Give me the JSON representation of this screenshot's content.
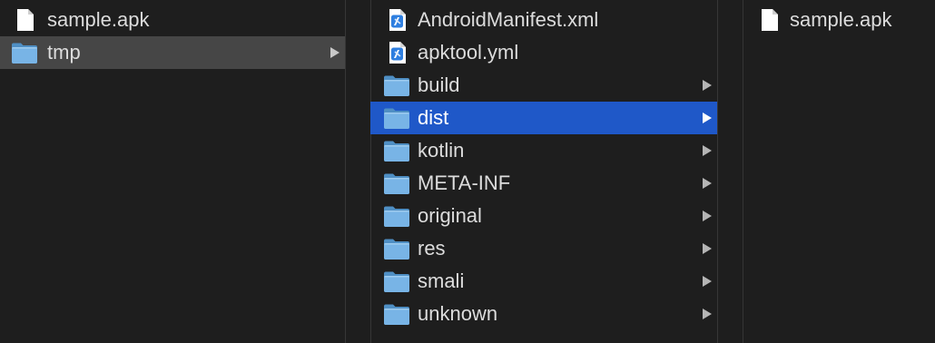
{
  "columns": [
    {
      "items": [
        {
          "name": "sample.apk",
          "type": "file",
          "state": "normal",
          "has_children": false
        },
        {
          "name": "tmp",
          "type": "folder",
          "state": "parent-selected",
          "has_children": true
        }
      ]
    },
    {
      "items": [
        {
          "name": "AndroidManifest.xml",
          "type": "xml-file",
          "state": "normal",
          "has_children": false
        },
        {
          "name": "apktool.yml",
          "type": "xml-file",
          "state": "normal",
          "has_children": false
        },
        {
          "name": "build",
          "type": "folder",
          "state": "normal",
          "has_children": true
        },
        {
          "name": "dist",
          "type": "folder",
          "state": "selected",
          "has_children": true
        },
        {
          "name": "kotlin",
          "type": "folder",
          "state": "normal",
          "has_children": true
        },
        {
          "name": "META-INF",
          "type": "folder",
          "state": "normal",
          "has_children": true
        },
        {
          "name": "original",
          "type": "folder",
          "state": "normal",
          "has_children": true
        },
        {
          "name": "res",
          "type": "folder",
          "state": "normal",
          "has_children": true
        },
        {
          "name": "smali",
          "type": "folder",
          "state": "normal",
          "has_children": true
        },
        {
          "name": "unknown",
          "type": "folder",
          "state": "normal",
          "has_children": true
        }
      ]
    },
    {
      "items": [
        {
          "name": "sample.apk",
          "type": "file",
          "state": "normal",
          "has_children": false
        }
      ]
    }
  ],
  "colors": {
    "background": "#1e1e1e",
    "selection": "#1f58c8",
    "inactive_selection": "#464646",
    "folder": "#6fa8dc",
    "text": "#dcdcdc"
  },
  "icons": {
    "file": "document-icon",
    "folder": "folder-icon",
    "xml-file": "xcode-document-icon",
    "chevron": "chevron-right-icon"
  }
}
